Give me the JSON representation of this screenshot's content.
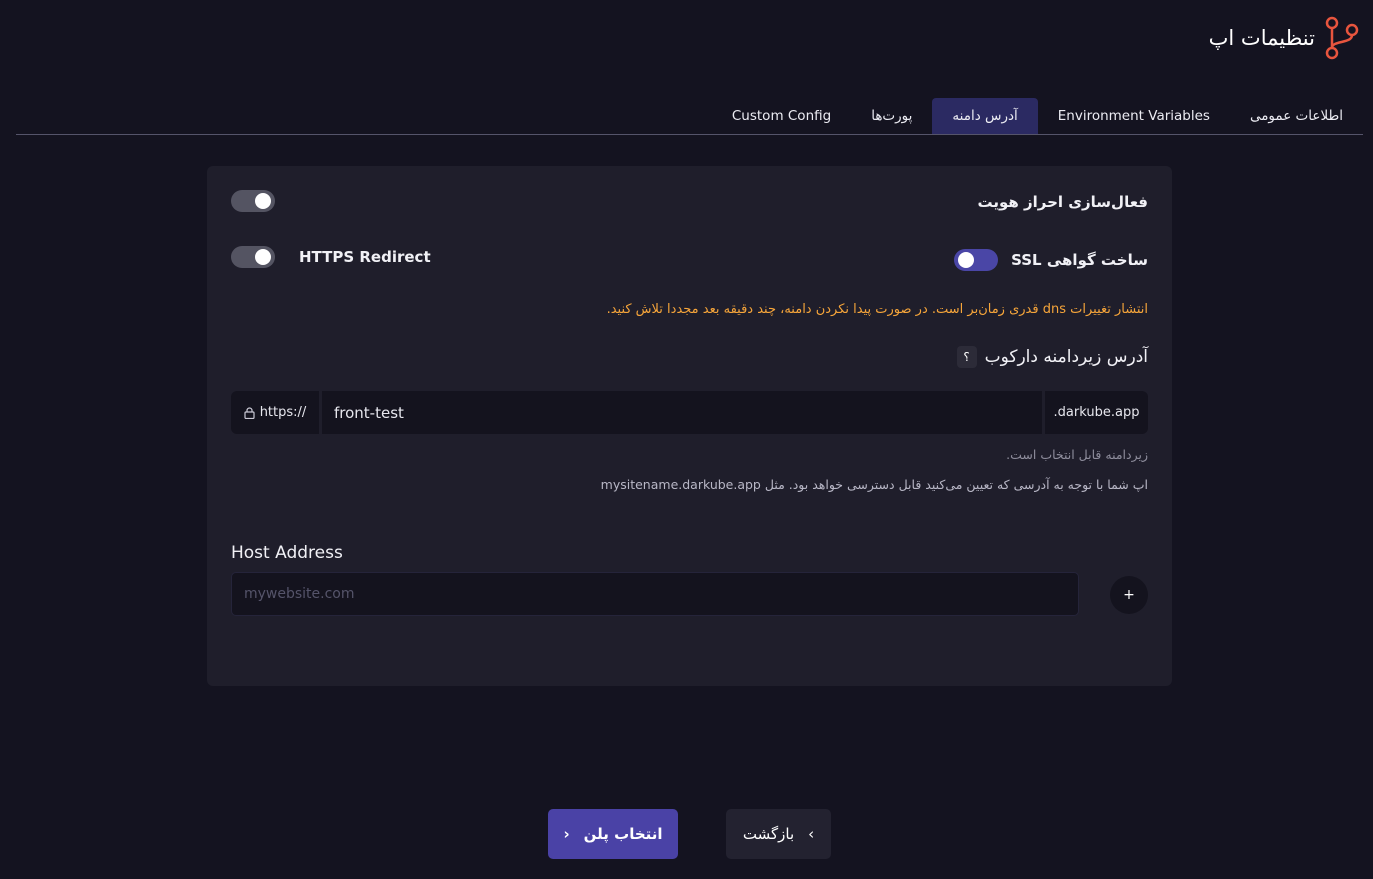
{
  "header": {
    "title": "تنظیمات اپ",
    "icon": "git-branch-icon",
    "accent_color": "#e8553e"
  },
  "tabs": [
    {
      "label": "اطلاعات عمومی",
      "active": false
    },
    {
      "label": "Environment Variables",
      "active": false
    },
    {
      "label": "آدرس دامنه",
      "active": true
    },
    {
      "label": "پورت‌ها",
      "active": false
    },
    {
      "label": "Custom Config",
      "active": false
    }
  ],
  "domain": {
    "auth_label": "فعال‌سازی احراز هویت",
    "auth_enabled": true,
    "ssl_label": "ساخت گواهی SSL",
    "ssl_enabled": false,
    "https_label": "HTTPS Redirect",
    "https_enabled": true,
    "dns_warning": "انتشار تغییرات dns قدری زمان‌بر است. در صورت پیدا نکردن دامنه، چند دقیقه بعد مجددا تلاش کنید.",
    "subdomain_title": "آدرس زیردامنه دارکوب",
    "help_badge": "؟",
    "url_prefix": "https://",
    "subdomain_value": "front-test",
    "url_suffix": ".darkube.app",
    "hint_selectable": "زیردامنه قابل انتخاب است.",
    "hint_access": "اپ شما با توجه به آدرسی که تعیین می‌کنید قابل دسترسی خواهد بود. مثل mysitename.darkube.app",
    "host_label": "Host Address",
    "host_placeholder": "mywebsite.com",
    "add_label": "+"
  },
  "footer": {
    "next_label": "انتخاب پلن",
    "back_label": "بازگشت"
  }
}
